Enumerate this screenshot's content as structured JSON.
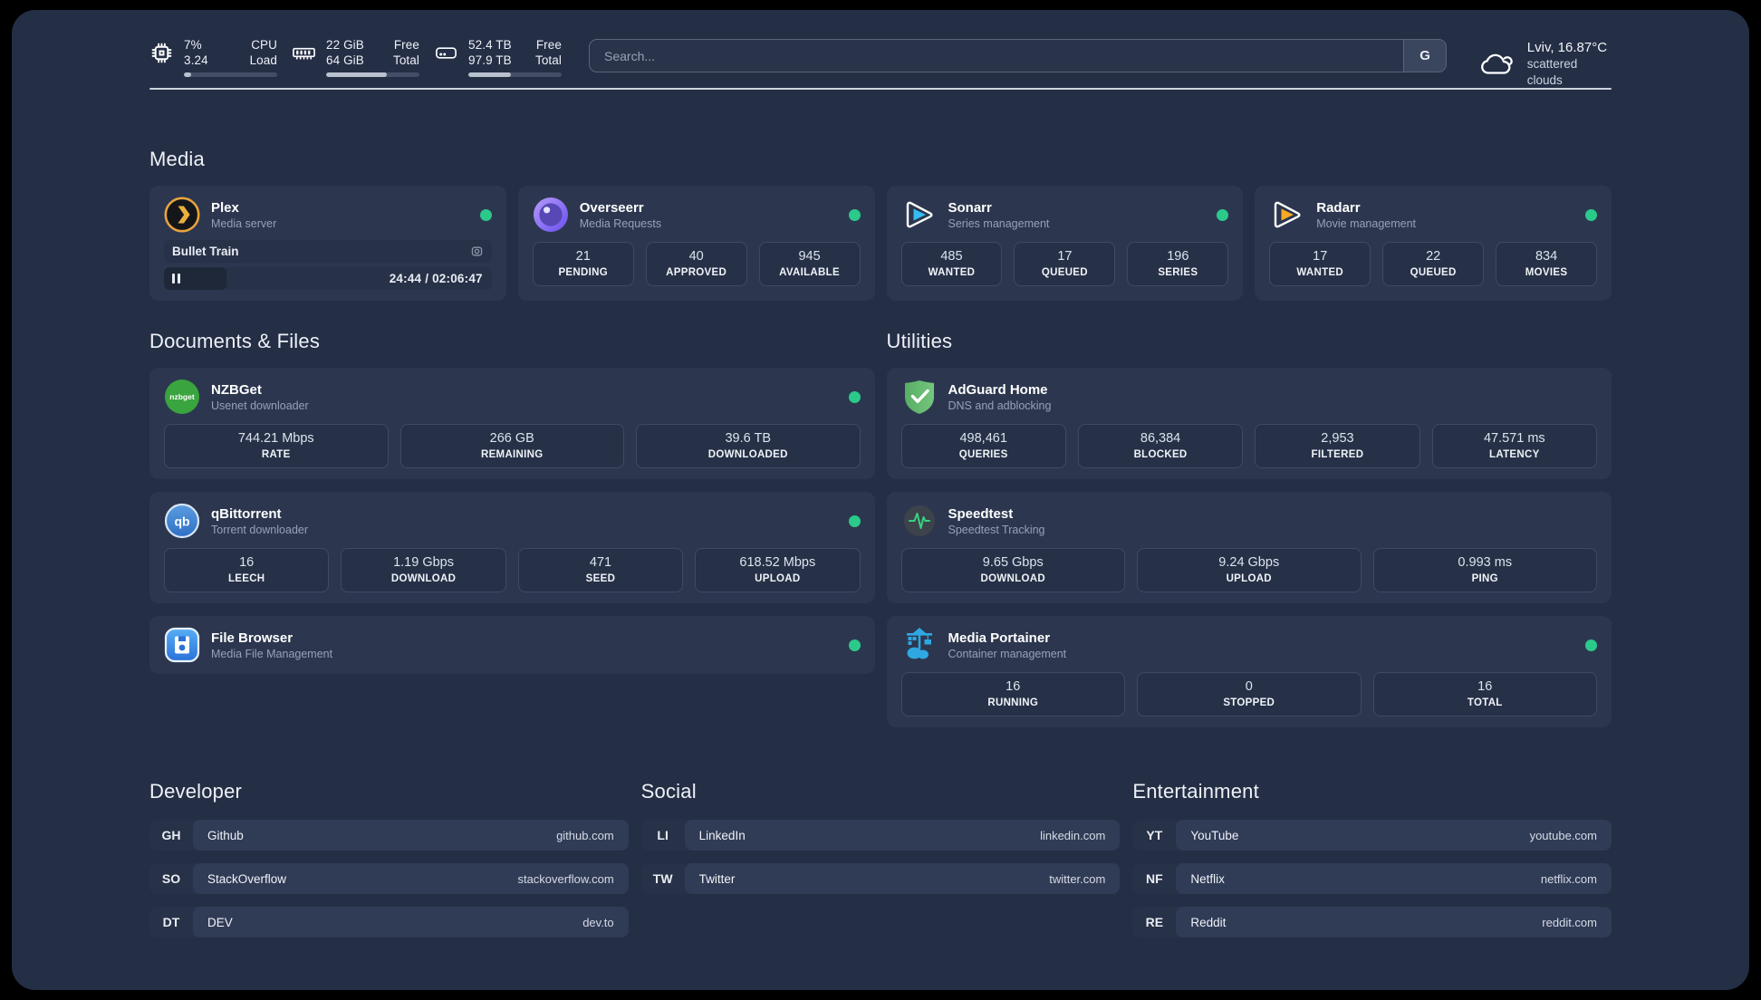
{
  "header": {
    "system": {
      "cpu": {
        "value_top": "7%",
        "value_bottom": "3.24",
        "label_top": "CPU",
        "label_bottom": "Load",
        "progress_pct": "8%"
      },
      "memory": {
        "value_top": "22 GiB",
        "value_bottom": "64 GiB",
        "label_top": "Free",
        "label_bottom": "Total",
        "progress_pct": "65%"
      },
      "storage": {
        "value_top": "52.4 TB",
        "value_bottom": "97.9 TB",
        "label_top": "Free",
        "label_bottom": "Total",
        "progress_pct": "46%"
      }
    },
    "search": {
      "placeholder": "Search...",
      "button": "G"
    },
    "weather": {
      "location": "Lviv, 16.87°C",
      "condition": "scattered clouds"
    }
  },
  "colors": {
    "status_online": "#2bc98a",
    "background": "#242e45",
    "card": "#2c374f"
  },
  "sections": {
    "media": {
      "title": "Media",
      "cards": [
        {
          "name": "Plex",
          "subtitle": "Media server",
          "online": true,
          "now_playing": {
            "title": "Bullet Train",
            "time": "24:44 / 02:06:47",
            "progress_pct": "19%"
          }
        },
        {
          "name": "Overseerr",
          "subtitle": "Media Requests",
          "online": true,
          "stats": [
            {
              "value": "21",
              "label": "PENDING"
            },
            {
              "value": "40",
              "label": "APPROVED"
            },
            {
              "value": "945",
              "label": "AVAILABLE"
            }
          ]
        },
        {
          "name": "Sonarr",
          "subtitle": "Series management",
          "online": true,
          "stats": [
            {
              "value": "485",
              "label": "WANTED"
            },
            {
              "value": "17",
              "label": "QUEUED"
            },
            {
              "value": "196",
              "label": "SERIES"
            }
          ]
        },
        {
          "name": "Radarr",
          "subtitle": "Movie management",
          "online": true,
          "stats": [
            {
              "value": "17",
              "label": "WANTED"
            },
            {
              "value": "22",
              "label": "QUEUED"
            },
            {
              "value": "834",
              "label": "MOVIES"
            }
          ]
        }
      ]
    },
    "documents": {
      "title": "Documents & Files",
      "cards": [
        {
          "name": "NZBGet",
          "subtitle": "Usenet downloader",
          "online": true,
          "stats": [
            {
              "value": "744.21 Mbps",
              "label": "RATE"
            },
            {
              "value": "266 GB",
              "label": "REMAINING"
            },
            {
              "value": "39.6 TB",
              "label": "DOWNLOADED"
            }
          ]
        },
        {
          "name": "qBittorrent",
          "subtitle": "Torrent downloader",
          "online": true,
          "stats": [
            {
              "value": "16",
              "label": "LEECH"
            },
            {
              "value": "1.19 Gbps",
              "label": "DOWNLOAD"
            },
            {
              "value": "471",
              "label": "SEED"
            },
            {
              "value": "618.52 Mbps",
              "label": "UPLOAD"
            }
          ]
        },
        {
          "name": "File Browser",
          "subtitle": "Media File Management",
          "online": true
        }
      ]
    },
    "utilities": {
      "title": "Utilities",
      "cards": [
        {
          "name": "AdGuard Home",
          "subtitle": "DNS and adblocking",
          "stats": [
            {
              "value": "498,461",
              "label": "QUERIES"
            },
            {
              "value": "86,384",
              "label": "BLOCKED"
            },
            {
              "value": "2,953",
              "label": "FILTERED"
            },
            {
              "value": "47.571 ms",
              "label": "LATENCY"
            }
          ]
        },
        {
          "name": "Speedtest",
          "subtitle": "Speedtest Tracking",
          "stats": [
            {
              "value": "9.65 Gbps",
              "label": "DOWNLOAD"
            },
            {
              "value": "9.24 Gbps",
              "label": "UPLOAD"
            },
            {
              "value": "0.993 ms",
              "label": "PING"
            }
          ]
        },
        {
          "name": "Media Portainer",
          "subtitle": "Container management",
          "online": true,
          "stats": [
            {
              "value": "16",
              "label": "RUNNING"
            },
            {
              "value": "0",
              "label": "STOPPED"
            },
            {
              "value": "16",
              "label": "TOTAL"
            }
          ]
        }
      ]
    },
    "link_groups": [
      {
        "title": "Developer",
        "items": [
          {
            "abbr": "GH",
            "name": "Github",
            "url": "github.com"
          },
          {
            "abbr": "SO",
            "name": "StackOverflow",
            "url": "stackoverflow.com"
          },
          {
            "abbr": "DT",
            "name": "DEV",
            "url": "dev.to"
          }
        ]
      },
      {
        "title": "Social",
        "items": [
          {
            "abbr": "LI",
            "name": "LinkedIn",
            "url": "linkedin.com"
          },
          {
            "abbr": "TW",
            "name": "Twitter",
            "url": "twitter.com"
          }
        ]
      },
      {
        "title": "Entertainment",
        "items": [
          {
            "abbr": "YT",
            "name": "YouTube",
            "url": "youtube.com"
          },
          {
            "abbr": "NF",
            "name": "Netflix",
            "url": "netflix.com"
          },
          {
            "abbr": "RE",
            "name": "Reddit",
            "url": "reddit.com"
          }
        ]
      }
    ]
  }
}
